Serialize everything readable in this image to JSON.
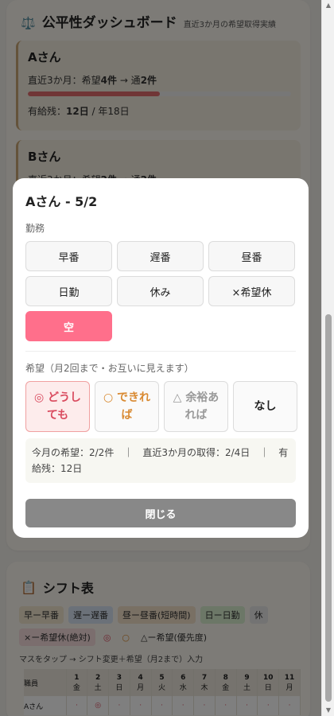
{
  "fairness": {
    "icon": "⚖️",
    "title": "公平性ダッシュボード",
    "subtitle": "直近3か月の希望取得実績",
    "staff": [
      {
        "name": "Aさん",
        "recent_prefix": "直近3か月：希望",
        "hopes": "4件",
        "arrow": " → 通",
        "got": "2件",
        "ratio": 0.5,
        "leave_label": "有給残：",
        "leave_value": "12日",
        "leave_total": " / 年18日"
      },
      {
        "name": "Bさん",
        "recent_prefix": "直近3か月：希望",
        "hopes": "2件",
        "arrow": " → 通",
        "got": "2件"
      }
    ]
  },
  "shift_table": {
    "icon": "📋",
    "title": "シフト表",
    "legend": [
      {
        "text": "早ー早番",
        "bg": "#f2e6cf",
        "fg": "#333"
      },
      {
        "text": "遅ー遅番",
        "bg": "#d7e3f2",
        "fg": "#333"
      },
      {
        "text": "昼ー昼番(短時間)",
        "bg": "#f3e1c9",
        "fg": "#333"
      },
      {
        "text": "日ー日勤",
        "bg": "#d9eecf",
        "fg": "#333"
      },
      {
        "text": "休",
        "bg": "#e6e6e6",
        "fg": "#333"
      },
      {
        "text": "×ー希望休(絶対)",
        "bg": "#f6dcdc",
        "fg": "#333"
      },
      {
        "text": "◎",
        "bg": "transparent",
        "fg": "#d94a5e"
      },
      {
        "text": "○",
        "bg": "transparent",
        "fg": "#d98a32"
      },
      {
        "text": "△ー希望(優先度)",
        "bg": "transparent",
        "fg": "#333"
      }
    ],
    "note": "マスをタップ → シフト変更＋希望（月2まで）入力",
    "staff_header": "職員",
    "days": [
      {
        "d": "1",
        "w": "金"
      },
      {
        "d": "2",
        "w": "土"
      },
      {
        "d": "3",
        "w": "日"
      },
      {
        "d": "4",
        "w": "月"
      },
      {
        "d": "5",
        "w": "火"
      },
      {
        "d": "6",
        "w": "水"
      },
      {
        "d": "7",
        "w": "木"
      },
      {
        "d": "8",
        "w": "金"
      },
      {
        "d": "9",
        "w": "土"
      },
      {
        "d": "10",
        "w": "日"
      },
      {
        "d": "11",
        "w": "月"
      }
    ],
    "first_row": {
      "name": "Aさん",
      "cells": [
        "·",
        "◎",
        "·",
        "·",
        "·",
        "·",
        "·",
        "·",
        "·",
        "·",
        "·"
      ]
    }
  },
  "modal": {
    "title": "Aさん - 5/2",
    "shift_label": "勤務",
    "shifts": [
      {
        "label": "早番",
        "active": false
      },
      {
        "label": "遅番",
        "active": false
      },
      {
        "label": "昼番",
        "active": false
      },
      {
        "label": "日勤",
        "active": false
      },
      {
        "label": "休み",
        "active": false
      },
      {
        "label": "×希望休",
        "active": false
      },
      {
        "label": "空",
        "active": true
      }
    ],
    "hope_label": "希望（月2回まで・お互いに見えます）",
    "hopes": [
      {
        "label": "◎ どうしても",
        "selected": true
      },
      {
        "label": "○ できれば",
        "selected": false
      },
      {
        "label": "△ 余裕あれば",
        "selected": false
      },
      {
        "label": "なし",
        "selected": false
      }
    ],
    "stats": "今月の希望：2/2件　｜　直近3か月の取得：2/4日　｜　有給残：12日",
    "close_label": "閉じる"
  }
}
